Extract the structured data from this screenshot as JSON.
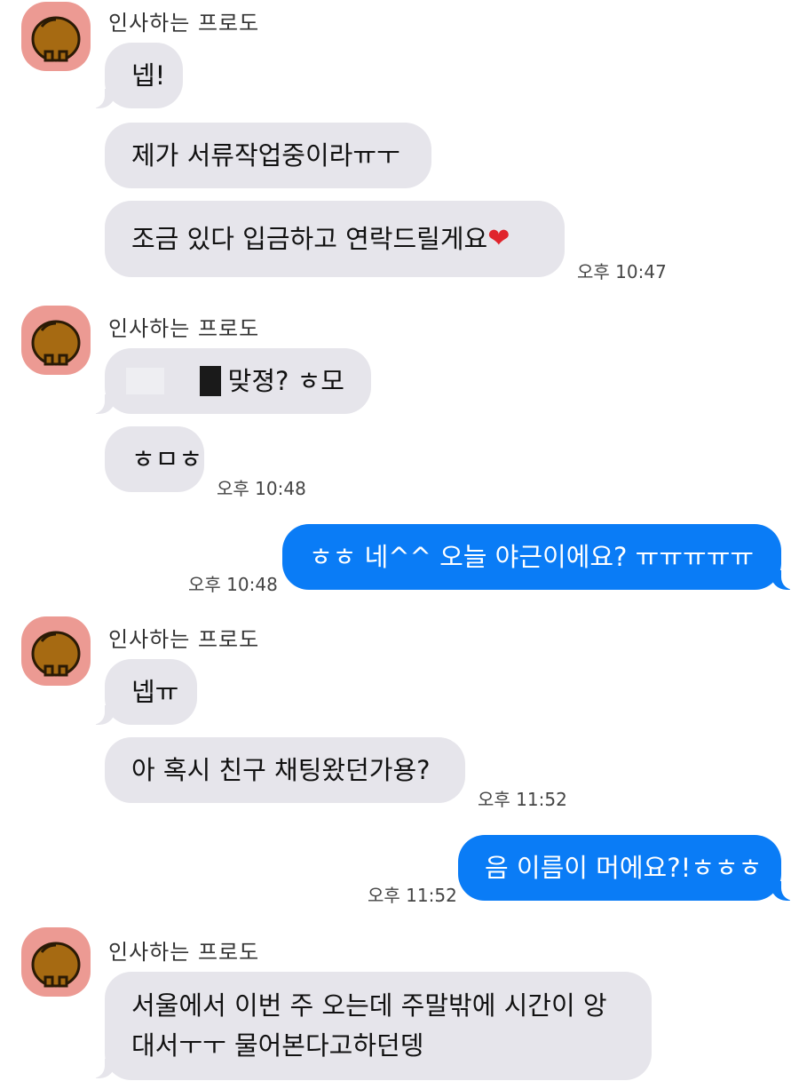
{
  "chat": {
    "sender_name": "인사하는 프로도",
    "groups": [
      {
        "messages": [
          "넵!",
          "제가 서류작업중이라ㅠㅜ",
          "조금 있다 입금하고 연락드릴게요"
        ],
        "heart": "❤",
        "time": "오후 10:47"
      },
      {
        "messages": [
          "맞졍? ㅎ모",
          "ㅎㅁㅎ"
        ],
        "time": "오후 10:48"
      },
      {
        "messages": [
          "넵ㅠ",
          "아 혹시 친구 채팅왔던가용?"
        ],
        "time": "오후 11:52"
      },
      {
        "messages": [
          "서울에서 이번 주 오는데 주말밖에 시간이 앙 대서ㅜㅜ 물어본다고하던뎅"
        ]
      }
    ],
    "outgoing": [
      {
        "text": "ㅎㅎ 네^^ 오늘 야근이에요? ㅠㅠㅠㅠㅠ",
        "time": "오후 10:48"
      },
      {
        "text": "음 이름이 머에요?!ㅎㅎㅎ",
        "time": "오후 11:52"
      }
    ]
  },
  "colors": {
    "incoming_bubble": "#e6e5eb",
    "outgoing_bubble": "#0a7cf6",
    "avatar_bg": "#ec9a93"
  },
  "icons": {
    "avatar": "frodo-bear-avatar-icon"
  }
}
